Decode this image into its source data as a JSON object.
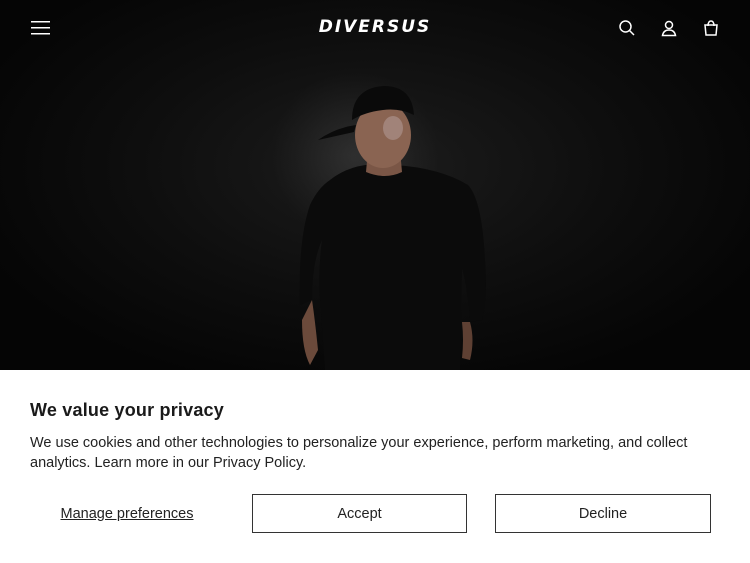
{
  "header": {
    "logo": "DIVERSUS",
    "icons": [
      "menu-icon",
      "search-icon",
      "account-icon",
      "cart-icon"
    ]
  },
  "hero": {
    "image": "model-black-tshirt-cap"
  },
  "cookie_banner": {
    "title": "We value your privacy",
    "text": "We use cookies and other technologies to personalize your experience, perform marketing, and collect analytics. Learn more in our Privacy Policy.",
    "manage_label": "Manage preferences",
    "accept_label": "Accept",
    "decline_label": "Decline"
  },
  "colors": {
    "background": "#000000",
    "banner": "#ffffff",
    "text": "#222222"
  }
}
